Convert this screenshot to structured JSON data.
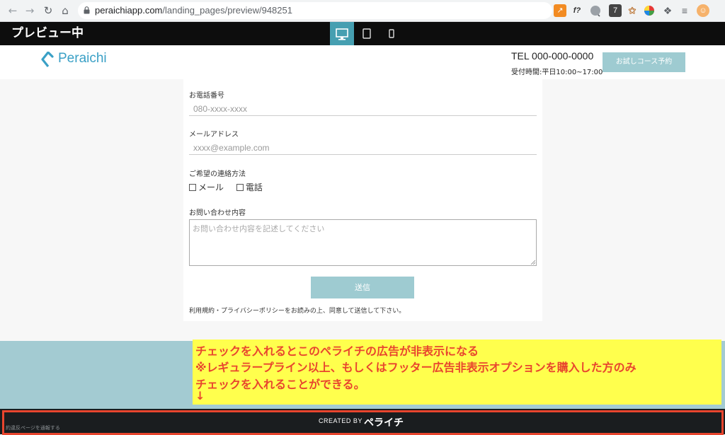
{
  "browser": {
    "url_host": "peraichiapp.com",
    "url_path": "/landing_pages/preview/948251",
    "extensions": [
      "chart-ext",
      "f?",
      "circle-ext",
      "7",
      "branch-ext",
      "color-wheel-ext",
      "puzzle-icon",
      "list-ext",
      "avatar"
    ]
  },
  "preview": {
    "label": "プレビュー中"
  },
  "header": {
    "logo_text": "Peraichi",
    "tel": "TEL 000-000-0000",
    "hours": "受付時間:平日10:00~17:00",
    "trial_button": "お試しコース予約"
  },
  "form": {
    "phone_label": "お電話番号",
    "phone_placeholder": "080-xxxx-xxxx",
    "email_label": "メールアドレス",
    "email_placeholder": "xxxx@example.com",
    "contact_label": "ご希望の連絡方法",
    "contact_options": [
      "メール",
      "電話"
    ],
    "inquiry_label": "お問い合わせ内容",
    "inquiry_placeholder": "お問い合わせ内容を記述してください",
    "submit": "送信",
    "terms": "利用規約・プライバシーポリシーをお読みの上、同意して送信して下さい。"
  },
  "annotation": {
    "lines": [
      "チェックを入れるとこのペライチの広告が非表示になる",
      "※レギュラープライン以上、もしくはフッター広告非表示オプションを購入した方のみ",
      "チェックを入れることができる。",
      "↓"
    ]
  },
  "footer": {
    "report": "約違反ページを通報する",
    "created_by": "CREATED BY",
    "brand": "ペライチ"
  },
  "colors": {
    "accent": "#469fb1",
    "button": "#9ecbd1",
    "annotation_bg": "#ffff4d",
    "annotation_text": "#e8452e"
  }
}
